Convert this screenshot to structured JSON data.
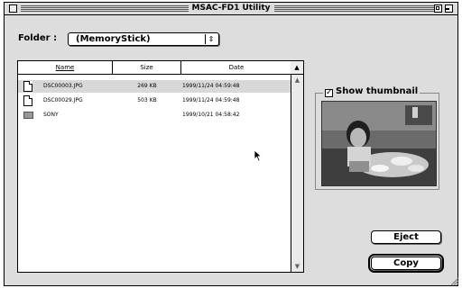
{
  "window": {
    "title": "MSAC-FD1 Utility"
  },
  "folder": {
    "label": "Folder :",
    "value": "(MemoryStick)"
  },
  "columns": {
    "name": "Name",
    "size": "Size",
    "date": "Date"
  },
  "files": [
    {
      "name": "DSC00003.JPG",
      "size": "269 KB",
      "date": "1999/11/24 04:59:48",
      "kind": "file",
      "selected": true
    },
    {
      "name": "DSC00029.JPG",
      "size": "503 KB",
      "date": "1999/11/24 04:59:48",
      "kind": "file",
      "selected": false
    },
    {
      "name": "SONY",
      "size": "",
      "date": "1999/10/21 04:58:42",
      "kind": "folder",
      "selected": false
    }
  ],
  "thumbnail": {
    "label": "Show thumbnail",
    "checked": true
  },
  "buttons": {
    "eject": "Eject",
    "copy": "Copy"
  },
  "icons": [
    "close-box-icon",
    "zoom-icon",
    "collapse-icon",
    "document-icon",
    "folder-icon",
    "checkmark-icon",
    "popup-arrows-icon",
    "sort-arrow-icon",
    "scroll-up-icon",
    "scroll-down-icon",
    "arrow-cursor-icon",
    "grow-box-icon"
  ]
}
